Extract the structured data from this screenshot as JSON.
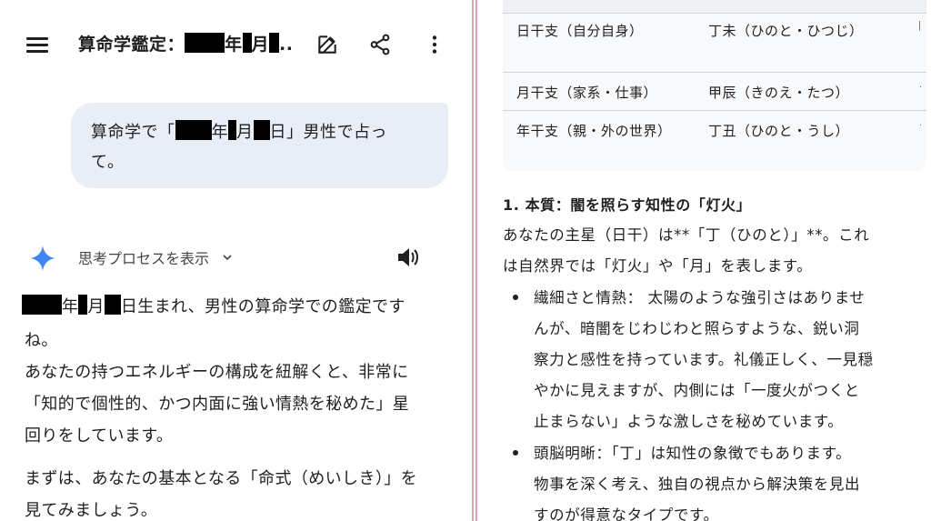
{
  "topbar": {
    "title_prefix": "算命学鑑定：",
    "title_year": "年",
    "title_month": "月",
    "title_ellipsis": ".."
  },
  "user_message": {
    "line1_prefix": "算命学で「",
    "year": "年",
    "month": "月",
    "day_suffix": "日」男性で占っ",
    "line2": "て。"
  },
  "response": {
    "thinking_label": "思考プロセスを表示",
    "line1_year": "年",
    "line1_month": "月",
    "line1_rest": "日生まれ、男性の算命学での鑑定です",
    "line2": "ね。",
    "line3": "あなたの持つエネルギーの構成を紐解くと、非常に",
    "line4": "「知的で個性的、かつ内面に強い情熱を秘めた」星",
    "line5": "回りをしています。",
    "line6": "まずは、あなたの基本となる「命式（めいしき）」を",
    "line7": "見てみましょう。"
  },
  "table": {
    "rows": [
      {
        "label": "日干支（自分自身）",
        "value": "丁未（ひのと・ひつじ）"
      },
      {
        "label": "月干支（家系・仕事）",
        "value": "甲辰（きのえ・たつ）"
      },
      {
        "label": "年干支（親・外の世界）",
        "value": "丁丑（ひのと・うし）"
      }
    ]
  },
  "article": {
    "heading": "1. 本質：闇を照らす知性の「灯火」",
    "intro_line1": "あなたの主星（日干）は**「丁（ひのと）」**。これ",
    "intro_line2": "は自然界では「灯火」や「月」を表します。",
    "bullet1": [
      "繊細さと情熱： 太陽のような強引さはありませ",
      "んが、暗闇をじわじわと照らすような、鋭い洞",
      "察力と感性を持っています。礼儀正しく、一見穏",
      "やかに見えますが、内側には「一度火がつくと",
      "止まらない」ような激しさを秘めています。"
    ],
    "bullet2": [
      "頭脳明晰：「丁」は知性の象徴でもあります。",
      "物事を深く考え、独自の視点から解決策を見出",
      "すのが得意なタイプです。"
    ]
  },
  "colors": {
    "bubble": "#e9eef6",
    "spark_blue": "#4285f4",
    "divider": "#d9a3a8",
    "table_bg": "#f8f9fa"
  }
}
